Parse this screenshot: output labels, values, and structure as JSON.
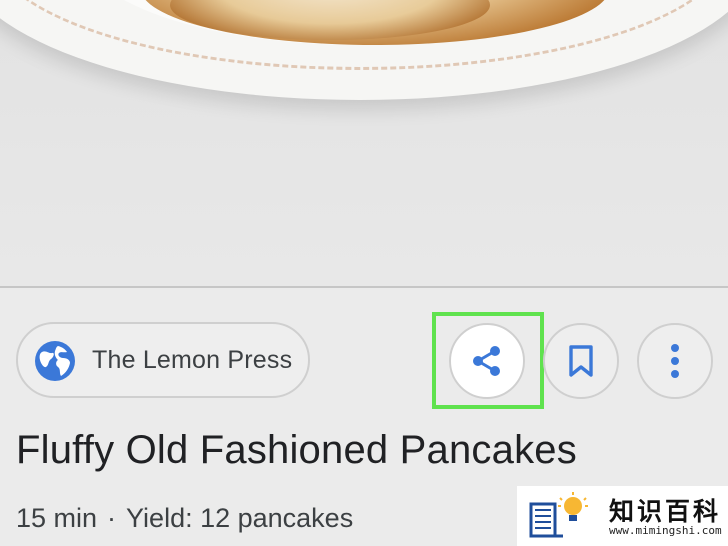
{
  "hero": {
    "image": "pancakes-on-plate-photo"
  },
  "publisher": {
    "name": "The Lemon Press",
    "icon": "globe-icon"
  },
  "actions": {
    "share_icon": "share-icon",
    "bookmark_icon": "bookmark-icon",
    "more_icon": "more-vertical-icon",
    "highlight_color": "#5fe24e"
  },
  "recipe": {
    "title": "Fluffy Old Fashioned Pancakes",
    "time": "15 min",
    "separator": "·",
    "yield": "Yield: 12 pancakes"
  },
  "watermark": {
    "cn": "知识百科",
    "url": "www.mimingshi.com"
  },
  "colors": {
    "accent_blue": "#3b78d8",
    "text_dark": "#202124",
    "chip_border": "#cfcfcf"
  }
}
